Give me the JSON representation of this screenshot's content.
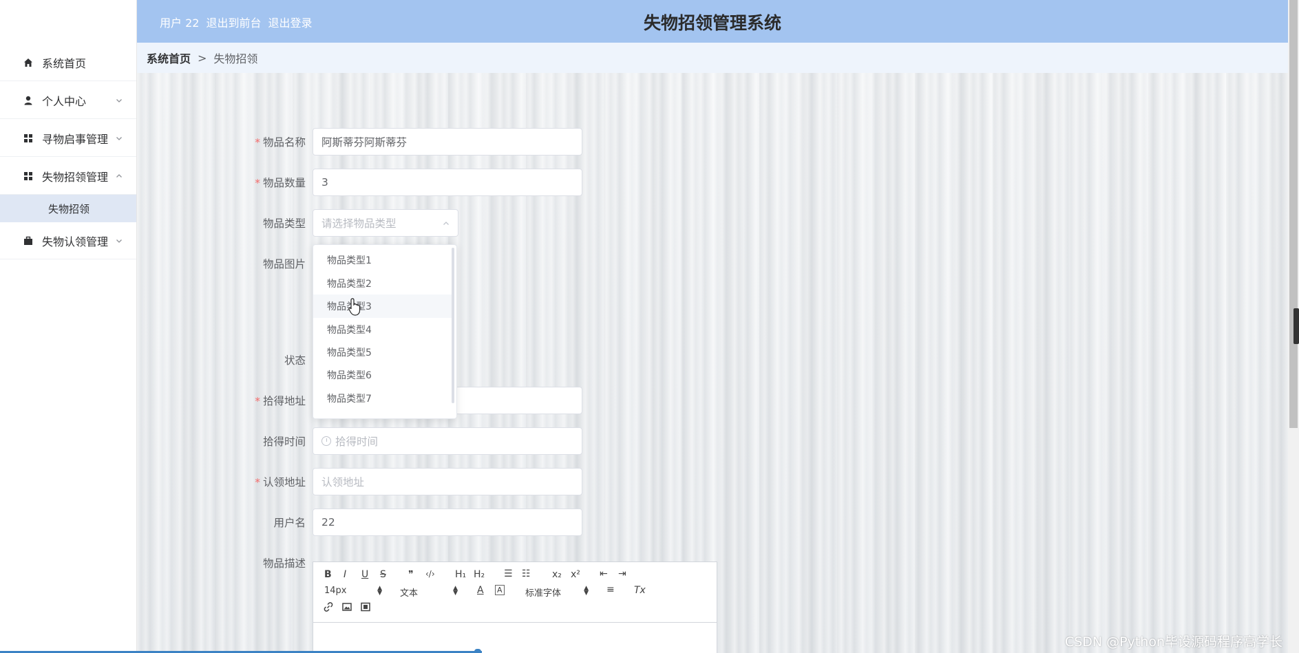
{
  "header": {
    "user_label": "用户 22",
    "back_to_front": "退出到前台",
    "logout": "退出登录",
    "title": "失物招领管理系统",
    "bg_color": "#a3c4f0"
  },
  "sidebar": {
    "items": [
      {
        "label": "系统首页",
        "icon": "home-icon"
      },
      {
        "label": "个人中心",
        "icon": "user-icon"
      },
      {
        "label": "寻物启事管理",
        "icon": "grid-icon"
      },
      {
        "label": "失物招领管理",
        "icon": "grid-icon"
      },
      {
        "label": "失物认领管理",
        "icon": "briefcase-icon"
      }
    ],
    "sub_items": [
      {
        "label": "失物招领"
      }
    ]
  },
  "breadcrumb": {
    "home": "系统首页",
    "separator": ">",
    "current": "失物招领"
  },
  "form": {
    "name": {
      "label": "物品名称",
      "value": "阿斯蒂芬阿斯蒂芬"
    },
    "quantity": {
      "label": "物品数量",
      "value": "3"
    },
    "type": {
      "label": "物品类型",
      "placeholder": "请选择物品类型"
    },
    "image": {
      "label": "物品图片"
    },
    "status": {
      "label": "状态"
    },
    "found_address": {
      "label": "拾得地址"
    },
    "found_time": {
      "label": "拾得时间",
      "placeholder": "拾得时间"
    },
    "claim_address": {
      "label": "认领地址",
      "placeholder": "认领地址"
    },
    "username": {
      "label": "用户名",
      "value": "22"
    },
    "description": {
      "label": "物品描述"
    }
  },
  "dropdown": {
    "options": [
      "物品类型1",
      "物品类型2",
      "物品类型3",
      "物品类型4",
      "物品类型5",
      "物品类型6",
      "物品类型7"
    ],
    "hovered_index": 2
  },
  "editor": {
    "bold": "B",
    "italic": "I",
    "underline": "U",
    "strike": "S",
    "quote": "❞",
    "code": "‹/›",
    "h1": "H₁",
    "h2": "H₂",
    "ol": "☰",
    "ul": "☷",
    "sub": "x₂",
    "sup": "x²",
    "outdent": "⇤",
    "indent": "⇥",
    "size": "14px",
    "heading": "文本",
    "color": "A",
    "bg": "A",
    "font": "标准字体",
    "align": "≡",
    "clear": "Tx"
  },
  "watermark": "CSDN @Python毕设源码程序高学长"
}
